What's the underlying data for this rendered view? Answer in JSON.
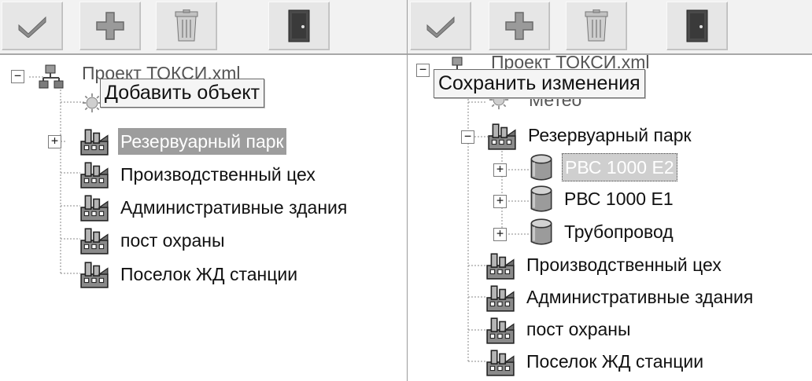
{
  "toolbar": {
    "buttons": [
      {
        "name": "checkmark-icon"
      },
      {
        "name": "plus-icon"
      },
      {
        "name": "trash-icon"
      },
      {
        "name": "exit-door-icon"
      }
    ]
  },
  "left_tree": {
    "root_label": "Проект ТОКСИ.xml",
    "child_partial": "",
    "items": [
      "Резервуарный парк",
      "Производственный цех",
      "Административные здания",
      "пост охраны",
      "Поселок ЖД станции"
    ],
    "tooltip": "Добавить объект"
  },
  "right_tree": {
    "root_label": "Проект ТОКСИ.xml",
    "meteo_label": "Метео",
    "park_label": "Резервуарный парк",
    "park_children": [
      "РВС 1000 Е2",
      "РВС 1000 Е1",
      "Трубопровод"
    ],
    "items": [
      "Производственный цех",
      "Административные здания",
      "пост охраны",
      "Поселок ЖД станции"
    ],
    "tooltip": "Сохранить изменения"
  },
  "colors": {
    "selection": "#9d9d9d",
    "toolbar": "#f2f2f2"
  }
}
